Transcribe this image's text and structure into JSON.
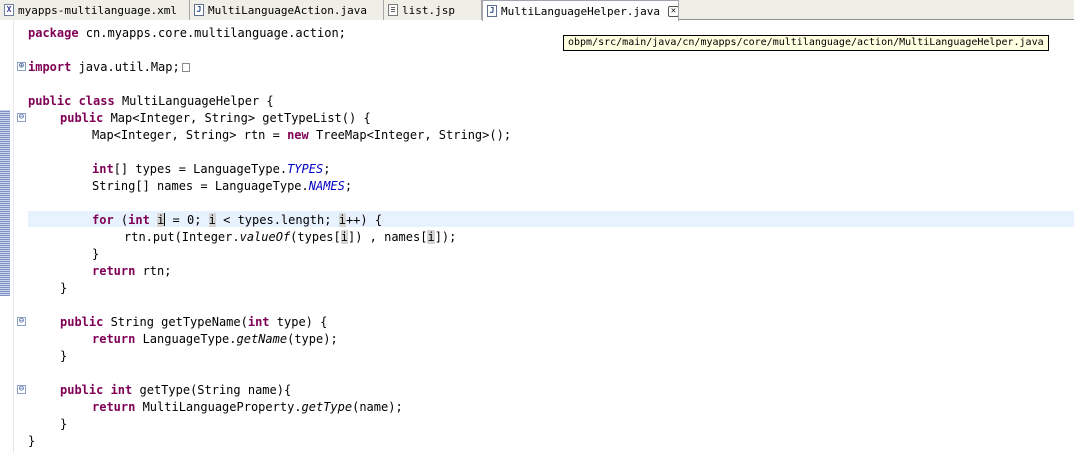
{
  "tabs": [
    {
      "label": "myapps-multilanguage.xml",
      "icon": "xml-file-icon",
      "icon_glyph": "X"
    },
    {
      "label": "MultiLanguageAction.java",
      "icon": "java-file-icon",
      "icon_glyph": "J"
    },
    {
      "label": "list.jsp",
      "icon": "jsp-file-icon",
      "icon_glyph": "≡"
    },
    {
      "label": "MultiLanguageHelper.java",
      "icon": "java-file-icon",
      "icon_glyph": "J",
      "active": true,
      "close_glyph": "✕"
    }
  ],
  "tooltip": "obpm/src/main/java/cn/myapps/core/multilanguage/action/MultiLanguageHelper.java",
  "code": {
    "pkg_kw": "package",
    "pkg_name": " cn.myapps.core.multilanguage.action;",
    "import_kw": "import",
    "import_name": " java.util.Map;",
    "class_public": "public",
    "class_kw": " class",
    "class_rest": " MultiLanguageHelper {",
    "m1_public": "public",
    "m1_rest": " Map<Integer, String> getTypeList() {",
    "l_rtn_a": "Map<Integer, String> rtn = ",
    "l_rtn_new": "new",
    "l_rtn_b": " TreeMap<Integer, String>();",
    "l_types_int": "int",
    "l_types_a": "[] types = LanguageType.",
    "l_types_fld": "TYPES",
    "l_types_end": ";",
    "l_names_a": "String[] names = LanguageType.",
    "l_names_fld": "NAMES",
    "l_names_end": ";",
    "for_kw": "for",
    "for_a": " (",
    "for_int": "int",
    "for_sp": " ",
    "var_i": "i",
    "for_b": " = 0; ",
    "for_c": " < types.length; ",
    "for_d": "++) {",
    "put_a": "rtn.put(Integer.",
    "put_valueof": "valueOf",
    "put_b": "(types[",
    "put_c": "]) , names[",
    "put_d": "]);",
    "close_brace": "}",
    "ret_kw": "return",
    "ret_rtn": " rtn;",
    "m2_public": "public",
    "m2_a": " String getTypeName(",
    "m2_int": "int",
    "m2_b": " type) {",
    "ret2_a": " LanguageType.",
    "ret2_fn": "getName",
    "ret2_b": "(type);",
    "m3_public": "public",
    "m3_int": " int",
    "m3_b": " getType(String name){",
    "ret3_a": " MultiLanguageProperty.",
    "ret3_fn": "getType",
    "ret3_b": "(name);",
    "fold_minus": "⊖",
    "fold_plus": "⊕"
  },
  "colors": {
    "keyword": "#7f0055",
    "static_field": "#0000c0",
    "current_line": "#e8f2fe",
    "tooltip_bg": "#ffffe1"
  }
}
